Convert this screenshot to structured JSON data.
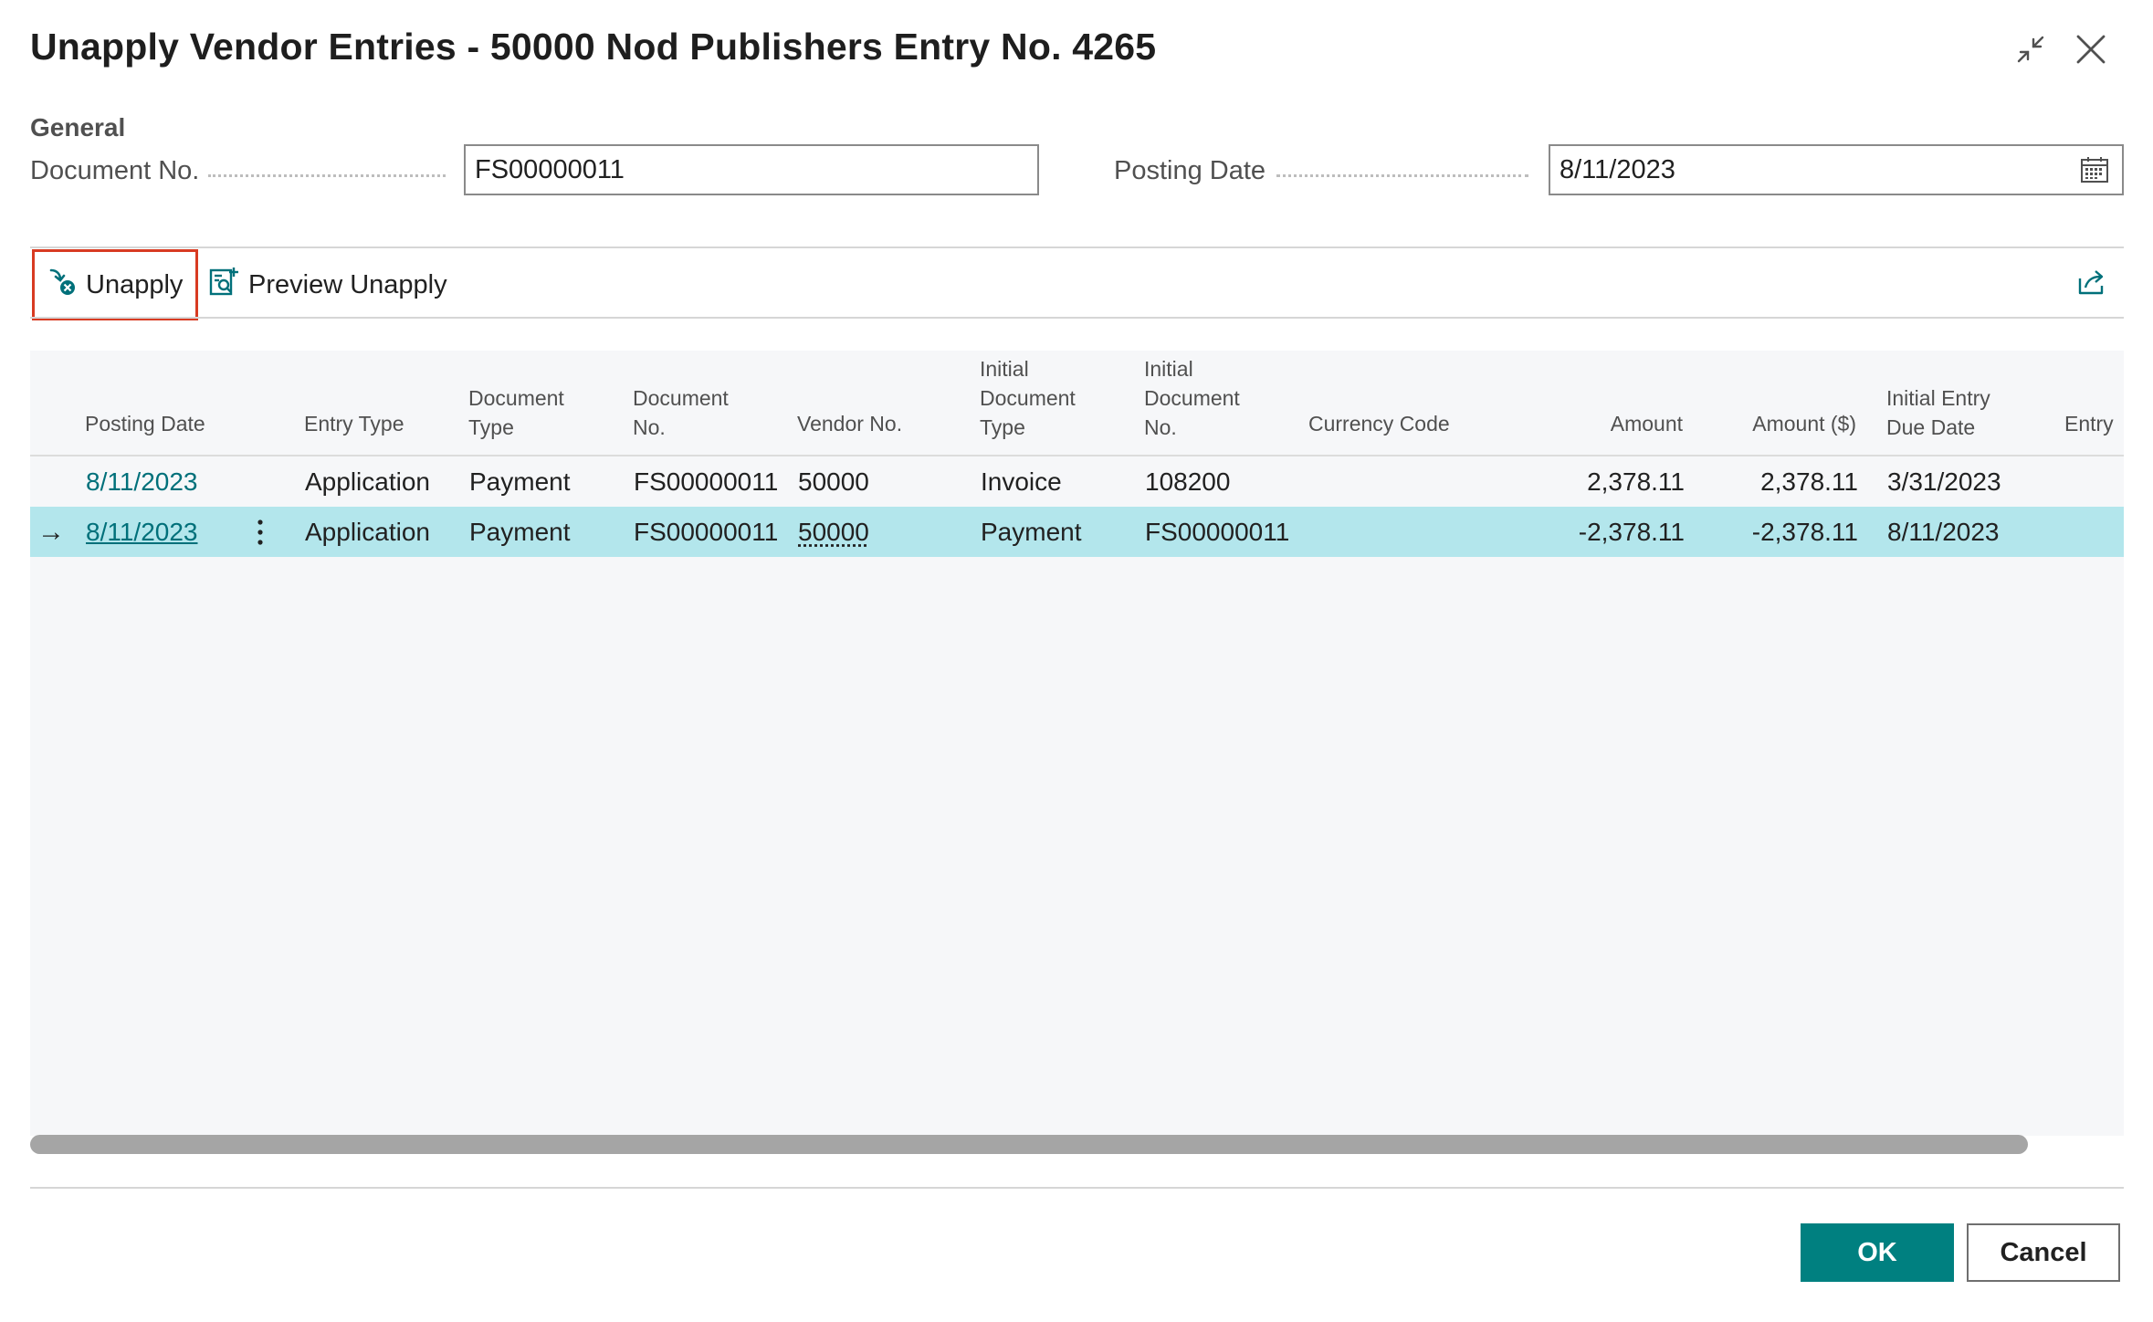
{
  "dialog": {
    "title": "Unapply Vendor Entries - 50000 Nod Publishers Entry No. 4265"
  },
  "general": {
    "section_label": "General",
    "document_no": {
      "label": "Document No.",
      "value": "FS00000011"
    },
    "posting_date": {
      "label": "Posting Date",
      "value": "8/11/2023"
    }
  },
  "actions": {
    "unapply": "Unapply",
    "preview_unapply": "Preview Unapply"
  },
  "table": {
    "columns": {
      "posting_date": "Posting Date",
      "entry_type": "Entry Type",
      "document_type": "Document Type",
      "document_no": "Document No.",
      "vendor_no": "Vendor No.",
      "initial_document_type": "Initial Document Type",
      "initial_document_no": "Initial Document No.",
      "currency_code": "Currency Code",
      "amount": "Amount",
      "amount_usd": "Amount ($)",
      "initial_entry_due_date": "Initial Entry Due Date",
      "entry_cut": "Entry"
    },
    "rows": [
      {
        "posting_date": "8/11/2023",
        "entry_type": "Application",
        "document_type": "Payment",
        "document_no": "FS00000011",
        "vendor_no": "50000",
        "initial_document_type": "Invoice",
        "initial_document_no": "108200",
        "currency_code": "",
        "amount": "2,378.11",
        "amount_usd": "2,378.11",
        "initial_entry_due_date": "3/31/2023",
        "selected": false
      },
      {
        "posting_date": "8/11/2023",
        "entry_type": "Application",
        "document_type": "Payment",
        "document_no": "FS00000011",
        "vendor_no": "50000",
        "initial_document_type": "Payment",
        "initial_document_no": "FS00000011",
        "currency_code": "",
        "amount": "-2,378.11",
        "amount_usd": "-2,378.11",
        "initial_entry_due_date": "8/11/2023",
        "selected": true
      }
    ],
    "selected_row_marker": "→"
  },
  "footer": {
    "ok": "OK",
    "cancel": "Cancel"
  },
  "icons": {
    "minimize": "collapse-arrows-icon",
    "close": "close-icon",
    "calendar": "calendar-icon",
    "unapply": "unapply-icon",
    "preview": "preview-icon",
    "share": "share-icon",
    "row_menu": "vertical-ellipsis-icon"
  },
  "colors": {
    "accent": "#008080",
    "link": "#00707a",
    "selected_row": "#b3e6ec",
    "highlight_border": "#d83b22"
  }
}
